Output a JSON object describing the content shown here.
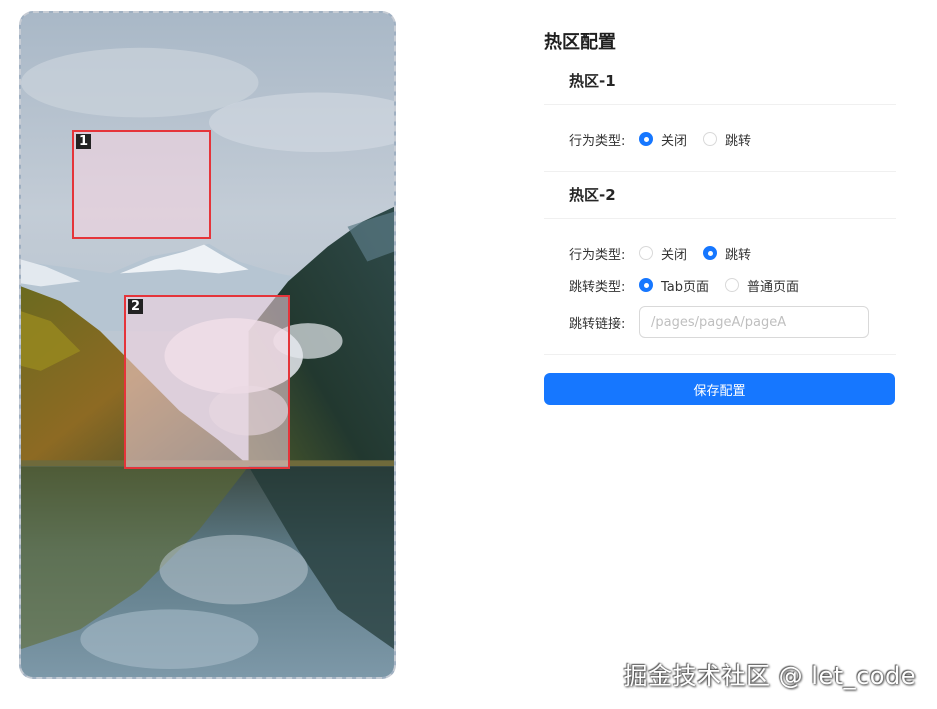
{
  "canvas": {
    "image": "lake-mountain-autumn-landscape",
    "hotspots": [
      {
        "index": "1"
      },
      {
        "index": "2"
      }
    ]
  },
  "panel": {
    "title": "热区配置",
    "hotspots": [
      {
        "title": "热区-1",
        "action_label": "行为类型:",
        "action_options": [
          "关闭",
          "跳转"
        ],
        "action_selected": "关闭"
      },
      {
        "title": "热区-2",
        "action_label": "行为类型:",
        "action_options": [
          "关闭",
          "跳转"
        ],
        "action_selected": "跳转",
        "jump_type_label": "跳转类型:",
        "jump_type_options": [
          "Tab页面",
          "普通页面"
        ],
        "jump_type_selected": "Tab页面",
        "link_label": "跳转链接:",
        "link_value": "",
        "link_placeholder": "/pages/pageA/pageA"
      }
    ],
    "save_label": "保存配置"
  },
  "watermark": "掘金技术社区 @ let_code",
  "colors": {
    "primary": "#1677ff",
    "hotspot_border": "#e5343a"
  }
}
